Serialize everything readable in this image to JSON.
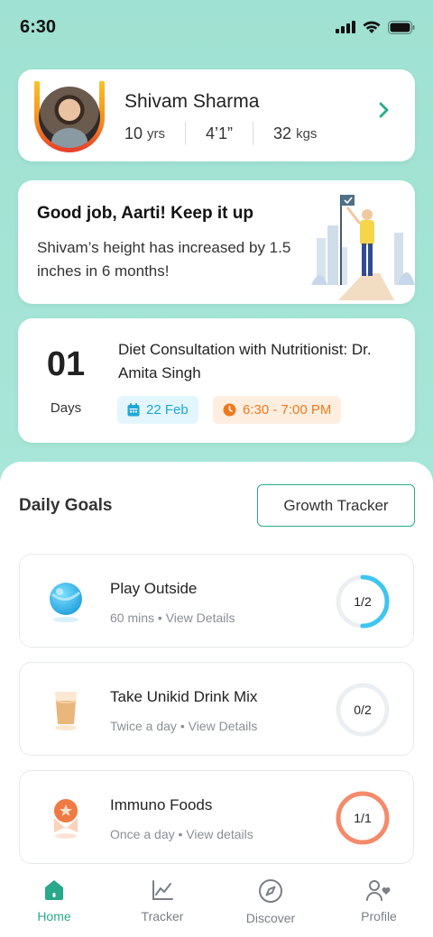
{
  "status_bar": {
    "time": "6:30"
  },
  "profile": {
    "name": "Shivam Sharma",
    "age_value": "10",
    "age_unit": "yrs",
    "height_value": "4’1”",
    "weight_value": "32",
    "weight_unit": "kgs"
  },
  "praise": {
    "title": "Good job, Aarti! Keep it up",
    "message": "Shivam’s height has increased by 1.5 inches in 6 months!"
  },
  "consultation": {
    "days_count": "01",
    "days_label": "Days",
    "title": "Diet Consultation with Nutritionist: Dr. Amita Singh",
    "date": "22 Feb",
    "time": "6:30 - 7:00 PM"
  },
  "goals_section": {
    "title": "Daily Goals",
    "growth_tracker_label": "Growth Tracker"
  },
  "goals": [
    {
      "title": "Play Outside",
      "subtitle": "60 mins • View Details",
      "progress_label": "1/2",
      "progress": 0.5,
      "ring_color": "#3ec6f0",
      "icon": "ball-icon"
    },
    {
      "title": "Take Unikid Drink Mix",
      "subtitle": "Twice a day • View Details",
      "progress_label": "0/2",
      "progress": 0,
      "ring_color": "#3ec6f0",
      "icon": "drink-glass-icon"
    },
    {
      "title": "Immuno Foods",
      "subtitle": "Once a day • View details",
      "progress_label": "1/1",
      "progress": 1,
      "ring_color": "#f48a6a",
      "icon": "medal-icon"
    }
  ],
  "tabbar": {
    "items": [
      {
        "label": "Home",
        "icon": "home-icon",
        "active": true
      },
      {
        "label": "Tracker",
        "icon": "chart-icon",
        "active": false
      },
      {
        "label": "Discover",
        "icon": "compass-icon",
        "active": false
      },
      {
        "label": "Profile",
        "icon": "profile-heart-icon",
        "active": false
      }
    ]
  },
  "colors": {
    "accent": "#2aa98a",
    "background": "#a7e4d5",
    "date_chip": "#1ea7d8",
    "time_chip": "#ee7a1d"
  }
}
